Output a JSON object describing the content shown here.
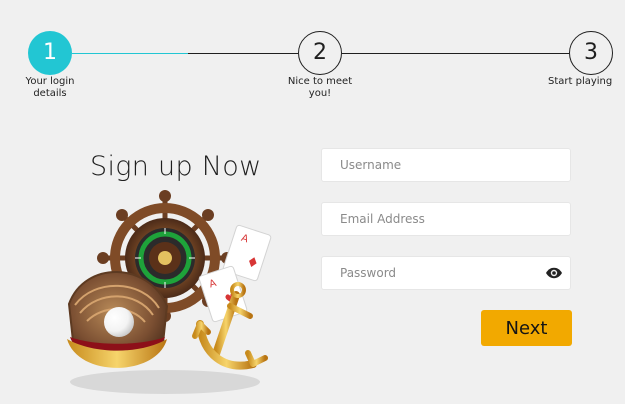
{
  "stepper": {
    "steps": [
      {
        "number": "1",
        "caption": "Your login\ndetails",
        "state": "active"
      },
      {
        "number": "2",
        "caption": "Nice to meet\nyou!",
        "state": "inactive"
      },
      {
        "number": "3",
        "caption": "Start playing",
        "state": "inactive"
      }
    ],
    "active_color": "#22c6d3",
    "inactive_color": "#1f1f1f"
  },
  "title": "Sign up Now",
  "illustration": {
    "semantic": "casino-themed decorative illustration with ship wheel, roulette wheel, playing cards, anchor and pearl shell"
  },
  "form": {
    "username": {
      "value": "",
      "placeholder": "Username"
    },
    "email": {
      "value": "",
      "placeholder": "Email Address"
    },
    "password": {
      "value": "",
      "placeholder": "Password"
    },
    "next_label": "Next"
  },
  "colors": {
    "background": "#f0f0f0",
    "accent": "#22c6d3",
    "button": "#f2a900",
    "text": "#1f1f1f"
  },
  "icons": {
    "password_toggle": "eye-icon"
  }
}
